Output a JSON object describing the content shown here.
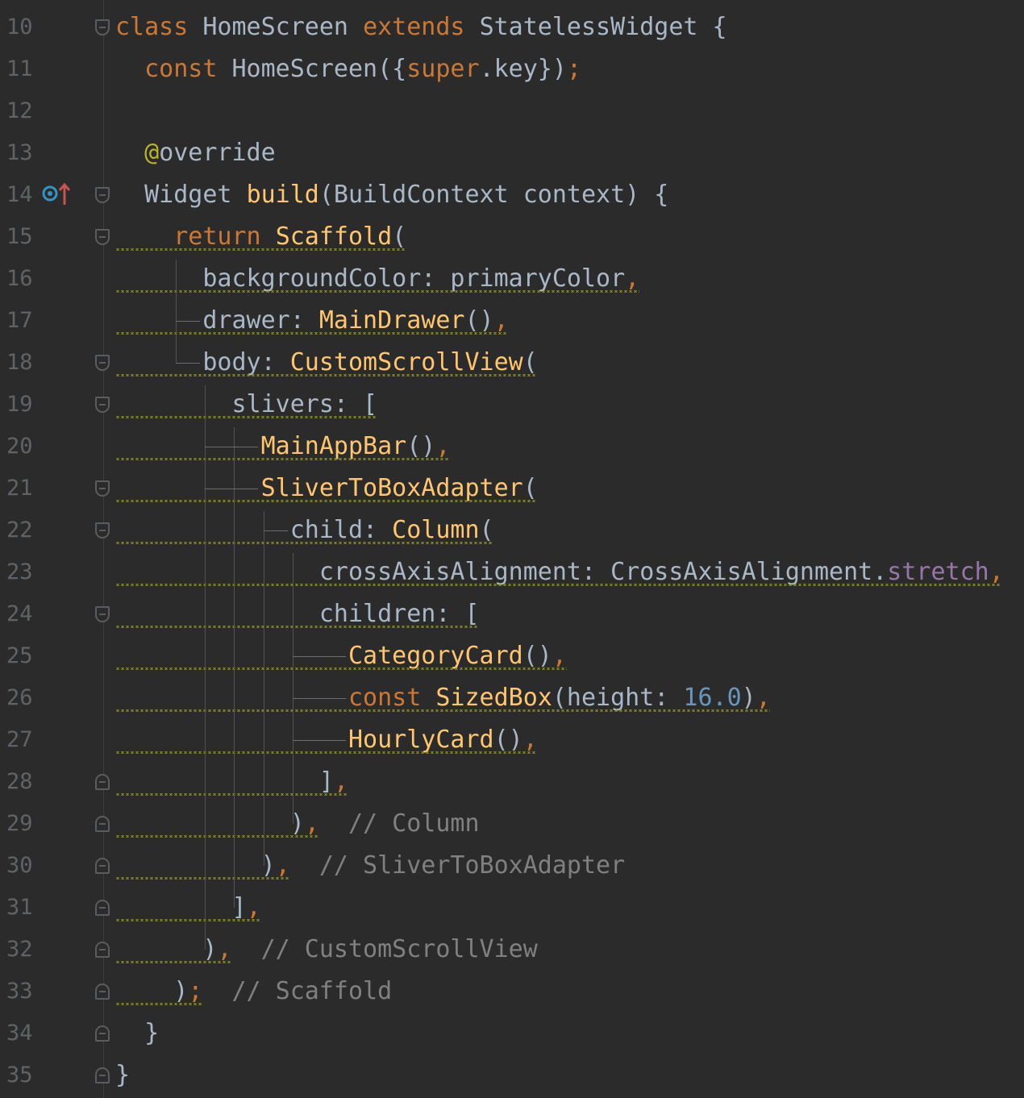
{
  "editor": {
    "language": "Dart",
    "colors": {
      "background": "#2b2b2b",
      "keyword": "#cc7832",
      "class": "#ffc66d",
      "number": "#6897bb",
      "comment": "#808080",
      "annotation": "#bbb529",
      "property": "#9876aa",
      "text": "#a9b7c6",
      "line_number": "#606366"
    },
    "gutter_icons": [
      "override-implements-icon"
    ],
    "lines": [
      {
        "n": "10",
        "fold": "open",
        "tokens": [
          {
            "t": "class ",
            "c": "kw"
          },
          {
            "t": "HomeScreen ",
            "c": ""
          },
          {
            "t": "extends ",
            "c": "kw"
          },
          {
            "t": "StatelessWidget {",
            "c": ""
          }
        ]
      },
      {
        "n": "11",
        "fold": "",
        "tokens": [
          {
            "t": "  const ",
            "c": "kw"
          },
          {
            "t": "HomeScreen({",
            "c": ""
          },
          {
            "t": "super",
            "c": "kw"
          },
          {
            "t": ".key})",
            "c": ""
          },
          {
            "t": ";",
            "c": "punc"
          }
        ]
      },
      {
        "n": "12",
        "fold": "",
        "tokens": []
      },
      {
        "n": "13",
        "fold": "",
        "tokens": [
          {
            "t": "  ",
            "c": ""
          },
          {
            "t": "@",
            "c": "ann"
          },
          {
            "t": "override",
            "c": ""
          }
        ]
      },
      {
        "n": "14",
        "fold": "open",
        "tokens": [
          {
            "t": "  Widget ",
            "c": ""
          },
          {
            "t": "build",
            "c": "cls"
          },
          {
            "t": "(BuildContext context) {",
            "c": ""
          }
        ]
      },
      {
        "n": "15",
        "fold": "open",
        "tokens": [
          {
            "t": "    return ",
            "c": "kw"
          },
          {
            "t": "Scaffold",
            "c": "cls"
          },
          {
            "t": "(",
            "c": ""
          }
        ]
      },
      {
        "n": "16",
        "fold": "",
        "tokens": [
          {
            "t": "      backgroundColor: primaryColor",
            "c": ""
          },
          {
            "t": ",",
            "c": "punc"
          }
        ]
      },
      {
        "n": "17",
        "fold": "",
        "tokens": [
          {
            "t": "      drawer: ",
            "c": ""
          },
          {
            "t": "MainDrawer",
            "c": "cls"
          },
          {
            "t": "()",
            "c": ""
          },
          {
            "t": ",",
            "c": "punc"
          }
        ]
      },
      {
        "n": "18",
        "fold": "open",
        "tokens": [
          {
            "t": "      body: ",
            "c": ""
          },
          {
            "t": "CustomScrollView",
            "c": "cls"
          },
          {
            "t": "(",
            "c": ""
          }
        ]
      },
      {
        "n": "19",
        "fold": "open",
        "tokens": [
          {
            "t": "        slivers: [",
            "c": ""
          }
        ]
      },
      {
        "n": "20",
        "fold": "",
        "tokens": [
          {
            "t": "          ",
            "c": ""
          },
          {
            "t": "MainAppBar",
            "c": "cls"
          },
          {
            "t": "()",
            "c": ""
          },
          {
            "t": ",",
            "c": "punc"
          }
        ]
      },
      {
        "n": "21",
        "fold": "open",
        "tokens": [
          {
            "t": "          ",
            "c": ""
          },
          {
            "t": "SliverToBoxAdapter",
            "c": "cls"
          },
          {
            "t": "(",
            "c": ""
          }
        ]
      },
      {
        "n": "22",
        "fold": "open",
        "tokens": [
          {
            "t": "            child: ",
            "c": ""
          },
          {
            "t": "Column",
            "c": "cls"
          },
          {
            "t": "(",
            "c": ""
          }
        ]
      },
      {
        "n": "23",
        "fold": "",
        "tokens": [
          {
            "t": "              crossAxisAlignment: CrossAxisAlignment.",
            "c": ""
          },
          {
            "t": "stretch",
            "c": "prop"
          },
          {
            "t": ",",
            "c": "punc"
          }
        ]
      },
      {
        "n": "24",
        "fold": "open",
        "tokens": [
          {
            "t": "              children: [",
            "c": ""
          }
        ]
      },
      {
        "n": "25",
        "fold": "",
        "tokens": [
          {
            "t": "                ",
            "c": ""
          },
          {
            "t": "CategoryCard",
            "c": "cls"
          },
          {
            "t": "()",
            "c": ""
          },
          {
            "t": ",",
            "c": "punc"
          }
        ]
      },
      {
        "n": "26",
        "fold": "",
        "tokens": [
          {
            "t": "                ",
            "c": ""
          },
          {
            "t": "const ",
            "c": "kw"
          },
          {
            "t": "SizedBox",
            "c": "cls"
          },
          {
            "t": "(height: ",
            "c": ""
          },
          {
            "t": "16.0",
            "c": "num"
          },
          {
            "t": ")",
            "c": ""
          },
          {
            "t": ",",
            "c": "punc"
          }
        ]
      },
      {
        "n": "27",
        "fold": "",
        "tokens": [
          {
            "t": "                ",
            "c": ""
          },
          {
            "t": "HourlyCard",
            "c": "cls"
          },
          {
            "t": "()",
            "c": ""
          },
          {
            "t": ",",
            "c": "punc"
          }
        ]
      },
      {
        "n": "28",
        "fold": "close",
        "tokens": [
          {
            "t": "              ]",
            "c": ""
          },
          {
            "t": ",",
            "c": "punc"
          }
        ]
      },
      {
        "n": "29",
        "fold": "close",
        "tokens": [
          {
            "t": "            )",
            "c": ""
          },
          {
            "t": ",",
            "c": "punc"
          },
          {
            "t": "  // Column",
            "c": "cmt"
          }
        ]
      },
      {
        "n": "30",
        "fold": "close",
        "tokens": [
          {
            "t": "          )",
            "c": ""
          },
          {
            "t": ",",
            "c": "punc"
          },
          {
            "t": "  // SliverToBoxAdapter",
            "c": "cmt"
          }
        ]
      },
      {
        "n": "31",
        "fold": "close",
        "tokens": [
          {
            "t": "        ]",
            "c": ""
          },
          {
            "t": ",",
            "c": "punc"
          }
        ]
      },
      {
        "n": "32",
        "fold": "close",
        "tokens": [
          {
            "t": "      )",
            "c": ""
          },
          {
            "t": ",",
            "c": "punc"
          },
          {
            "t": "  // CustomScrollView",
            "c": "cmt"
          }
        ]
      },
      {
        "n": "33",
        "fold": "close",
        "tokens": [
          {
            "t": "    )",
            "c": ""
          },
          {
            "t": ";",
            "c": "punc"
          },
          {
            "t": "  // Scaffold",
            "c": "cmt"
          }
        ]
      },
      {
        "n": "34",
        "fold": "close",
        "tokens": [
          {
            "t": "  }",
            "c": ""
          }
        ]
      },
      {
        "n": "35",
        "fold": "close",
        "tokens": [
          {
            "t": "}",
            "c": ""
          }
        ]
      }
    ]
  }
}
